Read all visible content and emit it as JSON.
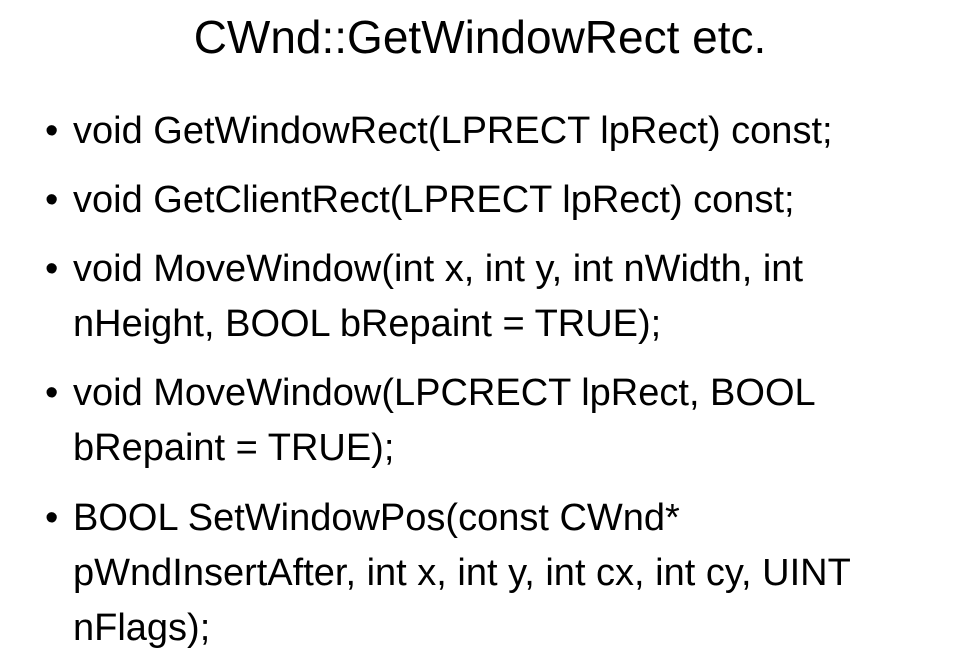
{
  "title": "CWnd::GetWindowRect etc.",
  "items": [
    "void GetWindowRect(LPRECT lpRect) const;",
    "void GetClientRect(LPRECT lpRect) const;",
    "void MoveWindow(int x, int y, int nWidth, int nHeight, BOOL bRepaint = TRUE);",
    "void MoveWindow(LPCRECT lpRect, BOOL bRepaint = TRUE);",
    "BOOL SetWindowPos(const CWnd* pWndInsertAfter, int x, int y, int cx, int cy, UINT nFlags);"
  ]
}
